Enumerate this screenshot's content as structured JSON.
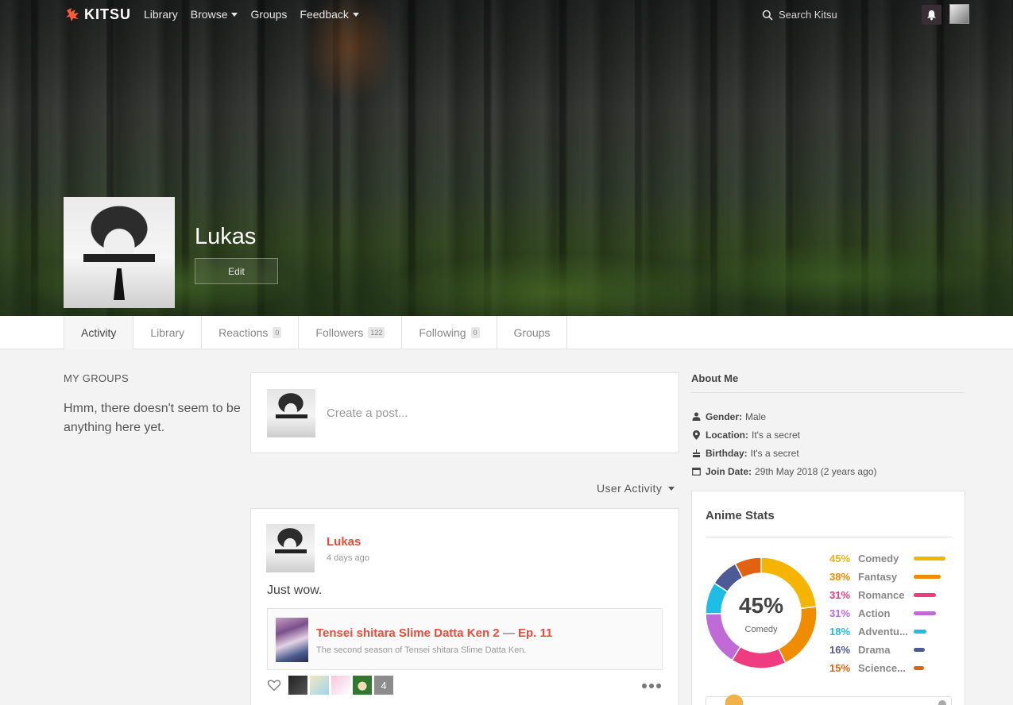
{
  "header": {
    "logo_text": "KITSU",
    "nav": [
      {
        "label": "Library",
        "dropdown": false
      },
      {
        "label": "Browse",
        "dropdown": true
      },
      {
        "label": "Groups",
        "dropdown": false
      },
      {
        "label": "Feedback",
        "dropdown": true
      }
    ],
    "search_placeholder": "Search Kitsu",
    "icons": [
      "logo-icon",
      "search-icon",
      "bell-icon",
      "avatar"
    ]
  },
  "profile": {
    "name": "Lukas",
    "edit_label": "Edit"
  },
  "tabs": [
    {
      "label": "Activity",
      "count": null,
      "active": true
    },
    {
      "label": "Library",
      "count": null,
      "active": false
    },
    {
      "label": "Reactions",
      "count": "0",
      "active": false
    },
    {
      "label": "Followers",
      "count": "122",
      "active": false
    },
    {
      "label": "Following",
      "count": "0",
      "active": false
    },
    {
      "label": "Groups",
      "count": null,
      "active": false
    }
  ],
  "groups": {
    "heading": "MY GROUPS",
    "empty_text": "Hmm, there doesn't seem to be anything here yet."
  },
  "composer": {
    "placeholder": "Create a post..."
  },
  "feed_filter": {
    "label": "User Activity"
  },
  "activity": {
    "author": "Lukas",
    "time": "4 days ago",
    "body": "Just wow.",
    "media": {
      "title": "Tensei shitara Slime Datta Ken 2",
      "separator": "—",
      "episode": "Ep. 11",
      "description": "The second season of Tensei shitara Slime Datta Ken."
    },
    "reactions_more": "4"
  },
  "about": {
    "heading": "About Me",
    "rows": [
      {
        "icon": "person-icon",
        "label": "Gender:",
        "value": "Male"
      },
      {
        "icon": "location-pin-icon",
        "label": "Location:",
        "value": "It's a secret"
      },
      {
        "icon": "cake-icon",
        "label": "Birthday:",
        "value": "It's a secret"
      },
      {
        "icon": "calendar-icon",
        "label": "Join Date:",
        "value": "29th May 2018 (2 years ago)"
      }
    ]
  },
  "anime_stats": {
    "title": "Anime Stats",
    "center_pct": "45%",
    "center_label": "Comedy"
  },
  "chart_data": {
    "type": "pie",
    "style": "donut",
    "categories": [
      "Comedy",
      "Fantasy",
      "Romance",
      "Action",
      "Adventu...",
      "Drama",
      "Science..."
    ],
    "labels": [
      "45%",
      "38%",
      "31%",
      "31%",
      "18%",
      "16%",
      "15%"
    ],
    "values": [
      45,
      38,
      31,
      31,
      18,
      16,
      15
    ],
    "colors": [
      "#f5b400",
      "#f08c00",
      "#ef3b7f",
      "#c06ad8",
      "#1dbde6",
      "#4c5a95",
      "#e2620f"
    ]
  },
  "colors": {
    "accent": "#e74c3c"
  }
}
